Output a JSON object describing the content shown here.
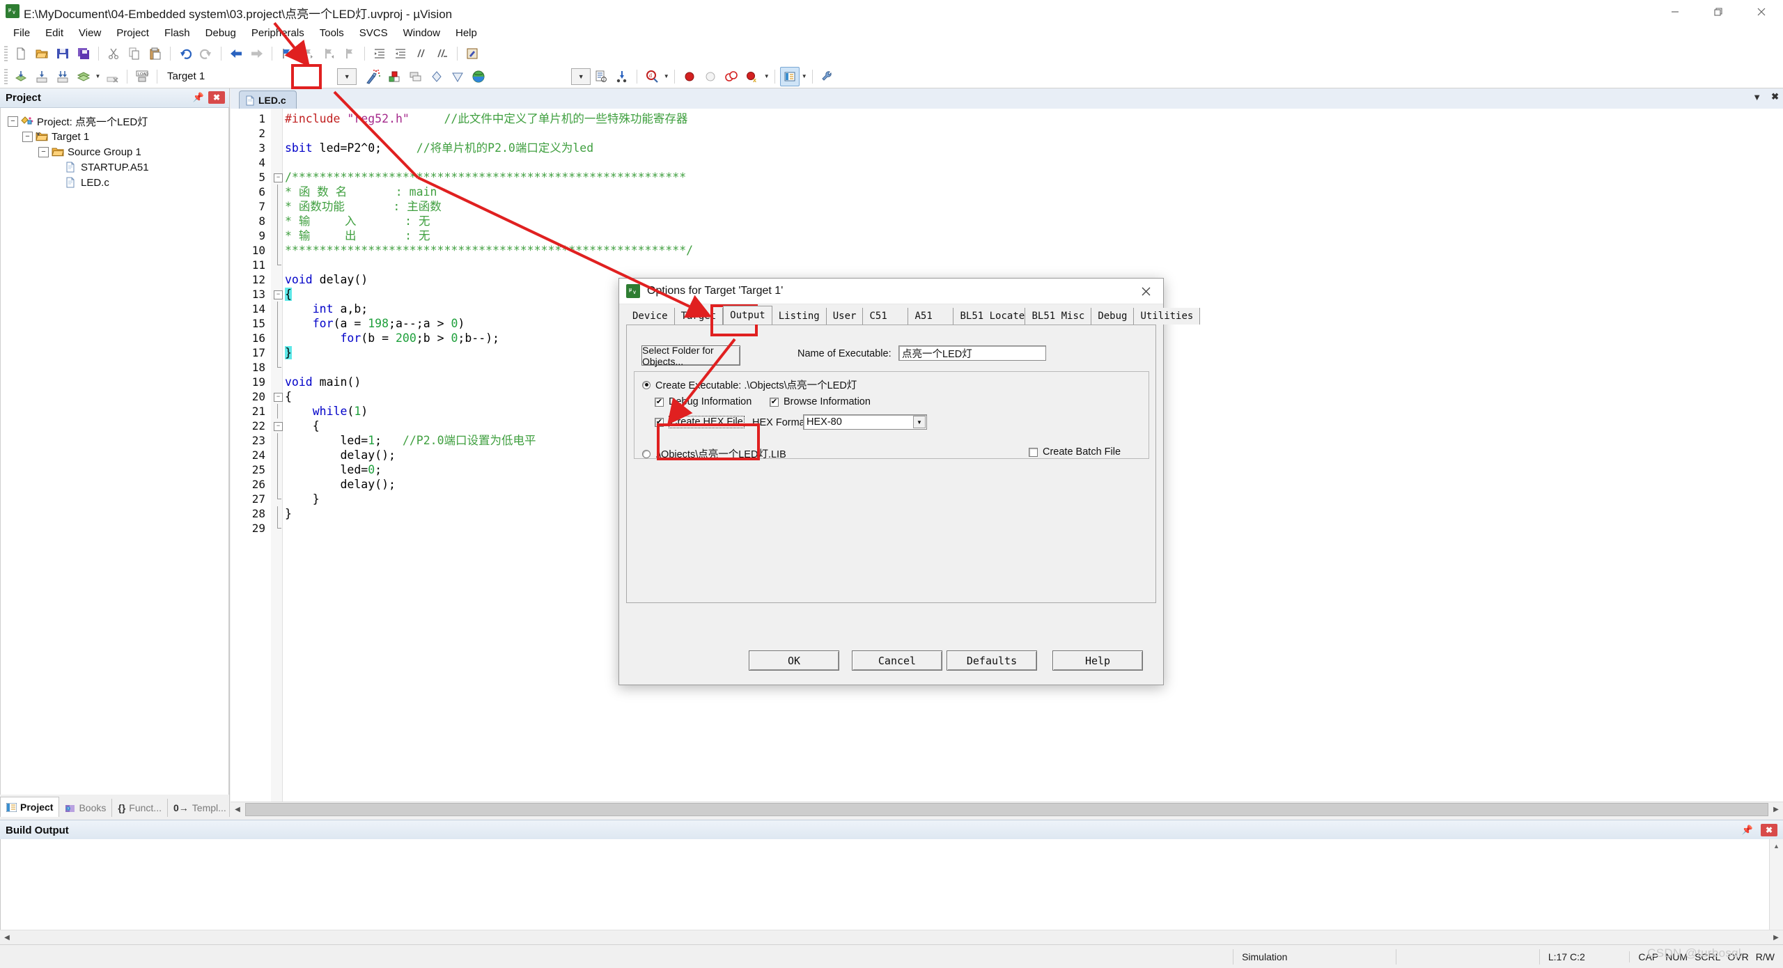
{
  "window": {
    "title": "E:\\MyDocument\\04-Embedded system\\03.project\\点亮一个LED灯.uvproj - µVision",
    "icon_label": "µV",
    "minimize": "—",
    "maximize": "❐",
    "close": "✕"
  },
  "menu": {
    "items": [
      "File",
      "Edit",
      "View",
      "Project",
      "Flash",
      "Debug",
      "Peripherals",
      "Tools",
      "SVCS",
      "Window",
      "Help"
    ]
  },
  "toolbar_main": {
    "icons": [
      "new-file-icon",
      "open-folder-icon",
      "save-icon",
      "save-all-icon",
      "cut-icon",
      "copy-icon",
      "paste-icon",
      "undo-icon",
      "redo-icon",
      "navigate-back-icon",
      "navigate-forward-icon",
      "bookmark-toggle-icon",
      "bookmark-prev-icon",
      "bookmark-next-icon",
      "bookmark-clear-icon",
      "indent-icon",
      "outdent-icon",
      "comment-icon",
      "uncomment-icon",
      "open-in-editor-icon"
    ]
  },
  "toolbar_build": {
    "target_value": "Target 1",
    "icons": [
      "translate-icon",
      "build-icon",
      "rebuild-icon",
      "batch-build-icon",
      "batch-build-dropdown",
      "stop-build-icon",
      "download-icon",
      "options-for-target-icon",
      "manage-components-icon",
      "manage-project-items-icon",
      "new-window-icon",
      "remove-icon",
      "configuration-wizard-icon"
    ]
  },
  "toolbar_debug": {
    "icons": [
      "dropdown-icon",
      "insert-template-icon",
      "find-in-files-icon",
      "debug-query-icon",
      "debug-query-dropdown",
      "insert-breakpoint-icon",
      "disable-breakpoint-icon",
      "disable-all-breakpoints-icon",
      "kill-all-breakpoints-icon",
      "kill-breakpoints-dropdown",
      "project-window-icon",
      "project-window-dropdown",
      "configuration-wizard-tool-icon"
    ]
  },
  "project_panel": {
    "title": "Project",
    "pin_icon": "pin-icon",
    "close_icon": "close-icon",
    "tree": [
      {
        "label": "Project: 点亮一个LED灯",
        "level": 0,
        "expander": "−",
        "icon": "project-icon"
      },
      {
        "label": "Target 1",
        "level": 1,
        "expander": "−",
        "icon": "target-folder-icon"
      },
      {
        "label": "Source Group 1",
        "level": 2,
        "expander": "−",
        "icon": "folder-icon"
      },
      {
        "label": "STARTUP.A51",
        "level": 3,
        "expander": "",
        "icon": "file-icon"
      },
      {
        "label": "LED.c",
        "level": 3,
        "expander": "",
        "icon": "file-icon"
      }
    ],
    "tabs": [
      {
        "label": "Project",
        "icon": "project-tab-icon",
        "active": true
      },
      {
        "label": "Books",
        "icon": "books-tab-icon",
        "active": false
      },
      {
        "label": "Funct...",
        "icon": "functions-tab-icon",
        "active": false
      },
      {
        "label": "Templ...",
        "icon": "templates-tab-icon",
        "active": false
      }
    ]
  },
  "editor": {
    "tab_label": "LED.c",
    "tab_icon": "c-file-icon",
    "dropdown_icon": "chevron-down-icon",
    "close_icon": "close-icon",
    "lines": [
      {
        "n": 1,
        "fold": "",
        "segs": [
          {
            "t": "#include ",
            "c": "pp"
          },
          {
            "t": "\"reg52.h\"",
            "c": "str"
          },
          {
            "t": "     ",
            "c": "txt"
          },
          {
            "t": "//此文件中定义了单片机的一些特殊功能寄存器",
            "c": "cm"
          }
        ]
      },
      {
        "n": 2,
        "fold": "",
        "segs": []
      },
      {
        "n": 3,
        "fold": "",
        "segs": [
          {
            "t": "sbit",
            "c": "k"
          },
          {
            "t": " led=P2^0;     ",
            "c": "txt"
          },
          {
            "t": "//将单片机的P2.0端口定义为led",
            "c": "cm"
          }
        ]
      },
      {
        "n": 4,
        "fold": "",
        "segs": []
      },
      {
        "n": 5,
        "fold": "minus",
        "segs": [
          {
            "t": "/*********************************************************",
            "c": "cm"
          }
        ]
      },
      {
        "n": 6,
        "fold": "bar",
        "segs": [
          {
            "t": "* 函 数 名       : main",
            "c": "cm"
          }
        ]
      },
      {
        "n": 7,
        "fold": "bar",
        "segs": [
          {
            "t": "* 函数功能       : 主函数",
            "c": "cm"
          }
        ]
      },
      {
        "n": 8,
        "fold": "bar",
        "segs": [
          {
            "t": "* 输     入       : 无",
            "c": "cm"
          }
        ]
      },
      {
        "n": 9,
        "fold": "bar",
        "segs": [
          {
            "t": "* 输     出       : 无",
            "c": "cm"
          }
        ]
      },
      {
        "n": 10,
        "fold": "bar",
        "segs": [
          {
            "t": "**********************************************************/",
            "c": "cm"
          }
        ]
      },
      {
        "n": 11,
        "fold": "end",
        "segs": []
      },
      {
        "n": 12,
        "fold": "",
        "segs": [
          {
            "t": "void ",
            "c": "k"
          },
          {
            "t": "delay()",
            "c": "txt"
          }
        ]
      },
      {
        "n": 13,
        "fold": "minus",
        "segs": [
          {
            "t": "{",
            "c": "hl"
          }
        ]
      },
      {
        "n": 14,
        "fold": "bar",
        "segs": [
          {
            "t": "    ",
            "c": "txt"
          },
          {
            "t": "int",
            "c": "k"
          },
          {
            "t": " a,b;",
            "c": "txt"
          }
        ]
      },
      {
        "n": 15,
        "fold": "bar",
        "segs": [
          {
            "t": "    ",
            "c": "txt"
          },
          {
            "t": "for",
            "c": "k"
          },
          {
            "t": "(a = ",
            "c": "txt"
          },
          {
            "t": "198",
            "c": "num"
          },
          {
            "t": ";a--;a > ",
            "c": "txt"
          },
          {
            "t": "0",
            "c": "num"
          },
          {
            "t": ")",
            "c": "txt"
          }
        ]
      },
      {
        "n": 16,
        "fold": "bar",
        "segs": [
          {
            "t": "        ",
            "c": "txt"
          },
          {
            "t": "for",
            "c": "k"
          },
          {
            "t": "(b = ",
            "c": "txt"
          },
          {
            "t": "200",
            "c": "num"
          },
          {
            "t": ";b > ",
            "c": "txt"
          },
          {
            "t": "0",
            "c": "num"
          },
          {
            "t": ";b--);",
            "c": "txt"
          }
        ]
      },
      {
        "n": 17,
        "fold": "bar",
        "segs": [
          {
            "t": "}",
            "c": "hl"
          }
        ]
      },
      {
        "n": 18,
        "fold": "end",
        "segs": []
      },
      {
        "n": 19,
        "fold": "",
        "segs": [
          {
            "t": "void ",
            "c": "k"
          },
          {
            "t": "main()",
            "c": "txt"
          }
        ]
      },
      {
        "n": 20,
        "fold": "minus",
        "segs": [
          {
            "t": "{",
            "c": "txt"
          }
        ]
      },
      {
        "n": 21,
        "fold": "bar",
        "segs": [
          {
            "t": "    ",
            "c": "txt"
          },
          {
            "t": "while",
            "c": "k"
          },
          {
            "t": "(",
            "c": "txt"
          },
          {
            "t": "1",
            "c": "num"
          },
          {
            "t": ")",
            "c": "txt"
          }
        ]
      },
      {
        "n": 22,
        "fold": "minus2",
        "segs": [
          {
            "t": "    {",
            "c": "txt"
          }
        ]
      },
      {
        "n": 23,
        "fold": "bar",
        "segs": [
          {
            "t": "        led=",
            "c": "txt"
          },
          {
            "t": "1",
            "c": "num"
          },
          {
            "t": ";   ",
            "c": "txt"
          },
          {
            "t": "//P2.0端口设置为低电平",
            "c": "cm"
          }
        ]
      },
      {
        "n": 24,
        "fold": "bar",
        "segs": [
          {
            "t": "        delay();",
            "c": "txt"
          }
        ]
      },
      {
        "n": 25,
        "fold": "bar",
        "segs": [
          {
            "t": "        led=",
            "c": "txt"
          },
          {
            "t": "0",
            "c": "num"
          },
          {
            "t": ";",
            "c": "txt"
          }
        ]
      },
      {
        "n": 26,
        "fold": "bar",
        "segs": [
          {
            "t": "        delay();",
            "c": "txt"
          }
        ]
      },
      {
        "n": 27,
        "fold": "end2",
        "segs": [
          {
            "t": "    }",
            "c": "txt"
          }
        ]
      },
      {
        "n": 28,
        "fold": "bar",
        "segs": [
          {
            "t": "}",
            "c": "txt"
          }
        ]
      },
      {
        "n": 29,
        "fold": "end",
        "segs": []
      }
    ]
  },
  "build_output": {
    "title": "Build Output",
    "content": "",
    "pin_icon": "pin-icon",
    "close_icon": "close-icon"
  },
  "status_bar": {
    "mode": "Simulation",
    "cursor": "L:17 C:2",
    "flags": [
      "CAP",
      "NUM",
      "SCRL",
      "OVR",
      "R/W"
    ],
    "watermark": "CSDN @turbosql"
  },
  "dialog": {
    "title": "Options for Target 'Target 1'",
    "icon_label": "µV",
    "close_label": "✕",
    "tabs": [
      "Device",
      "Target",
      "Output",
      "Listing",
      "User",
      "C51",
      "A51",
      "BL51 Locate",
      "BL51 Misc",
      "Debug",
      "Utilities"
    ],
    "active_tab": "Output",
    "select_folder_button": "Select Folder for Objects...",
    "name_of_executable_label": "Name of Executable:",
    "name_of_executable_value": "点亮一个LED灯",
    "create_executable_label": "Create Executable:  .\\Objects\\点亮一个LED灯",
    "create_executable_checked": true,
    "debug_information_label": "Debug Information",
    "debug_information_checked": true,
    "browse_information_label": "Browse Information",
    "browse_information_checked": true,
    "create_hex_file_label": "Create HEX File",
    "create_hex_file_checked": true,
    "hex_format_label": "HEX Format:",
    "hex_format_value": "HEX-80",
    "create_library_label": ".\\Objects\\点亮一个LED灯.LIB",
    "create_library_checked": false,
    "create_batch_file_label": "Create Batch File",
    "create_batch_file_checked": false,
    "buttons": {
      "ok": "OK",
      "cancel": "Cancel",
      "defaults": "Defaults",
      "help": "Help"
    }
  },
  "annotations": {
    "highlight_toolbar_options_icon": true,
    "highlight_output_tab": true,
    "highlight_create_hex_file": true,
    "arrow_color": "#e02020"
  }
}
